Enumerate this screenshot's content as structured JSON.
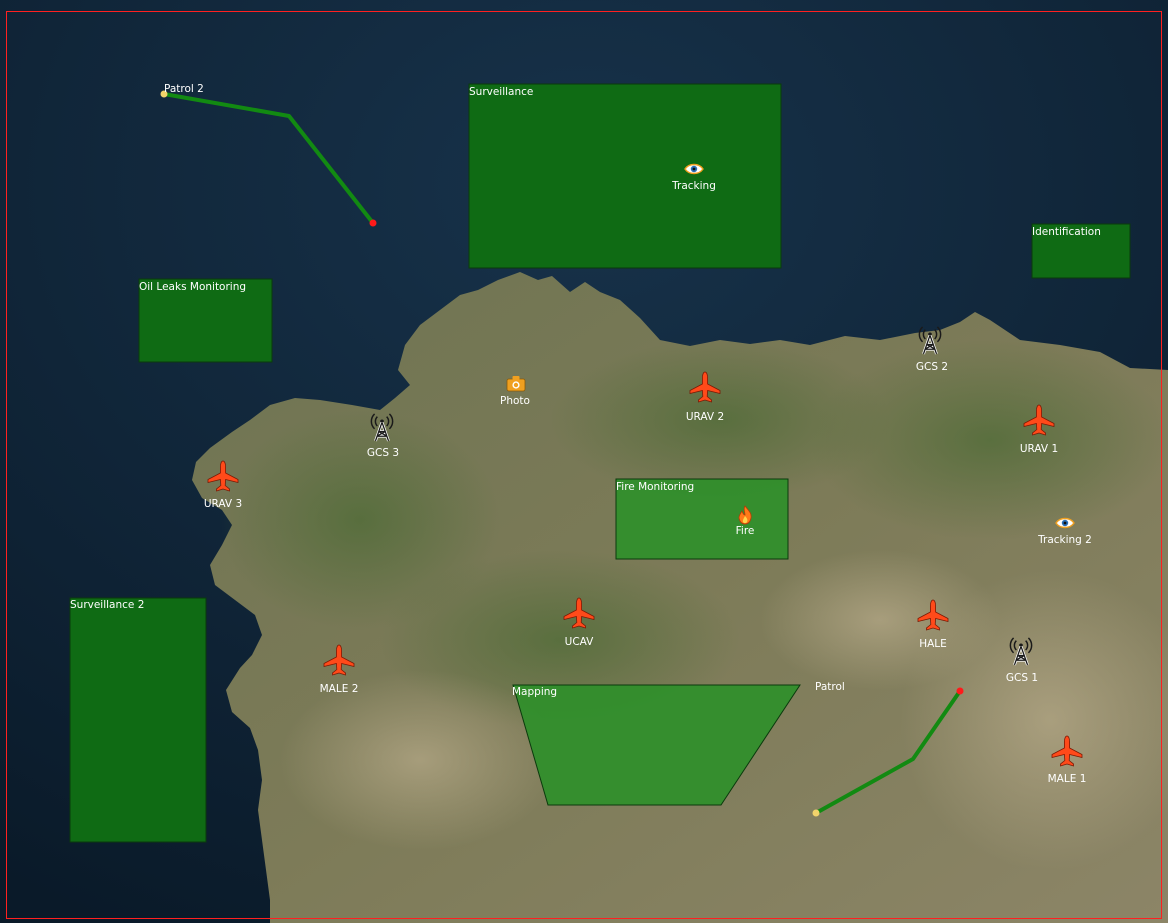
{
  "map": {
    "frame_color": "#ff2020",
    "zone_fill": "#0f6b14",
    "zone_fill_light": "#2f8f2a",
    "route_color": "#128a12"
  },
  "zones": [
    {
      "id": "surveillance",
      "label": "Surveillance"
    },
    {
      "id": "identification",
      "label": "Identification"
    },
    {
      "id": "oil-leaks",
      "label": "Oil Leaks Monitoring"
    },
    {
      "id": "fire-monitoring",
      "label": "Fire Monitoring"
    },
    {
      "id": "surveillance-2",
      "label": "Surveillance 2"
    },
    {
      "id": "mapping",
      "label": "Mapping"
    }
  ],
  "routes": [
    {
      "id": "patrol-2",
      "label": "Patrol 2"
    },
    {
      "id": "patrol",
      "label": "Patrol"
    }
  ],
  "aircraft": [
    {
      "id": "urav-2",
      "label": "URAV 2"
    },
    {
      "id": "urav-1",
      "label": "URAV 1"
    },
    {
      "id": "urav-3",
      "label": "URAV 3"
    },
    {
      "id": "ucav",
      "label": "UCAV"
    },
    {
      "id": "hale",
      "label": "HALE"
    },
    {
      "id": "male-2",
      "label": "MALE 2"
    },
    {
      "id": "male-1",
      "label": "MALE 1"
    }
  ],
  "ground_stations": [
    {
      "id": "gcs-2",
      "label": "GCS 2"
    },
    {
      "id": "gcs-3",
      "label": "GCS 3"
    },
    {
      "id": "gcs-1",
      "label": "GCS 1"
    }
  ],
  "tasks": [
    {
      "id": "tracking",
      "label": "Tracking",
      "icon": "eye-icon"
    },
    {
      "id": "tracking-2",
      "label": "Tracking 2",
      "icon": "eye-icon"
    },
    {
      "id": "photo",
      "label": "Photo",
      "icon": "camera-icon"
    },
    {
      "id": "fire",
      "label": "Fire",
      "icon": "fire-icon"
    }
  ],
  "colors": {
    "aircraft": "#ff4a1a",
    "task_icon": "#f0a020",
    "waypoint_start": "#f2d36b",
    "waypoint_end": "#ff1a1a"
  }
}
